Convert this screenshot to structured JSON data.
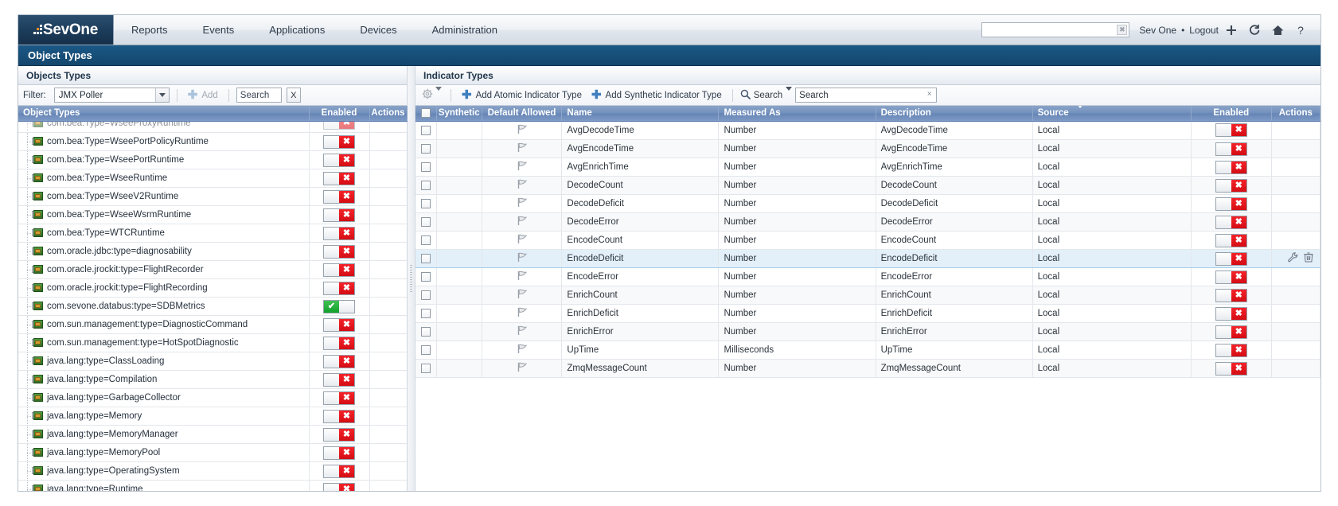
{
  "app": {
    "brand": "SevOne",
    "nav": [
      "Reports",
      "Events",
      "Applications",
      "Devices",
      "Administration"
    ],
    "search_value": "",
    "search_placeholder": "",
    "user": "Sev One",
    "separator": "•",
    "logout": "Logout",
    "icons": [
      "plus-icon",
      "refresh-icon",
      "home-icon",
      "help-icon"
    ],
    "page_title": "Object Types"
  },
  "left_panel": {
    "header": "Objects Types",
    "toolbar": {
      "filter_label": "Filter:",
      "filter_value": "JMX Poller",
      "add_label": "Add",
      "search_value": "Search",
      "clear_label": "X"
    },
    "columns": [
      "Object Types",
      "Enabled",
      "Actions"
    ],
    "rows": [
      {
        "name": "com.bea:Type=WseeProxyRuntime",
        "enabled": false,
        "partial": true
      },
      {
        "name": "com.bea:Type=WseePortPolicyRuntime",
        "enabled": false
      },
      {
        "name": "com.bea:Type=WseePortRuntime",
        "enabled": false
      },
      {
        "name": "com.bea:Type=WseeRuntime",
        "enabled": false
      },
      {
        "name": "com.bea:Type=WseeV2Runtime",
        "enabled": false
      },
      {
        "name": "com.bea:Type=WseeWsrmRuntime",
        "enabled": false
      },
      {
        "name": "com.bea:Type=WTCRuntime",
        "enabled": false
      },
      {
        "name": "com.oracle.jdbc:type=diagnosability",
        "enabled": false
      },
      {
        "name": "com.oracle.jrockit:type=FlightRecorder",
        "enabled": false
      },
      {
        "name": "com.oracle.jrockit:type=FlightRecording",
        "enabled": false
      },
      {
        "name": "com.sevone.databus:type=SDBMetrics",
        "enabled": true
      },
      {
        "name": "com.sun.management:type=DiagnosticCommand",
        "enabled": false
      },
      {
        "name": "com.sun.management:type=HotSpotDiagnostic",
        "enabled": false
      },
      {
        "name": "java.lang:type=ClassLoading",
        "enabled": false
      },
      {
        "name": "java.lang:type=Compilation",
        "enabled": false
      },
      {
        "name": "java.lang:type=GarbageCollector",
        "enabled": false
      },
      {
        "name": "java.lang:type=Memory",
        "enabled": false
      },
      {
        "name": "java.lang:type=MemoryManager",
        "enabled": false
      },
      {
        "name": "java.lang:type=MemoryPool",
        "enabled": false
      },
      {
        "name": "java.lang:type=OperatingSystem",
        "enabled": false
      },
      {
        "name": "java.lang:type=Runtime",
        "enabled": false
      }
    ]
  },
  "right_panel": {
    "header": "Indicator Types",
    "toolbar": {
      "add_atomic": "Add Atomic Indicator Type",
      "add_synthetic": "Add Synthetic Indicator Type",
      "search_button": "Search",
      "search_value": "Search",
      "clear_label": "×"
    },
    "columns": [
      "Synthetic",
      "Default Allowed",
      "Name",
      "Measured As",
      "Description",
      "Source",
      "Enabled",
      "Actions"
    ],
    "sorted_column": "Source",
    "sort_direction": "desc",
    "rows": [
      {
        "name": "AvgDecodeTime",
        "measured_as": "Number",
        "description": "AvgDecodeTime",
        "source": "Local",
        "enabled": false
      },
      {
        "name": "AvgEncodeTime",
        "measured_as": "Number",
        "description": "AvgEncodeTime",
        "source": "Local",
        "enabled": false
      },
      {
        "name": "AvgEnrichTime",
        "measured_as": "Number",
        "description": "AvgEnrichTime",
        "source": "Local",
        "enabled": false
      },
      {
        "name": "DecodeCount",
        "measured_as": "Number",
        "description": "DecodeCount",
        "source": "Local",
        "enabled": false
      },
      {
        "name": "DecodeDeficit",
        "measured_as": "Number",
        "description": "DecodeDeficit",
        "source": "Local",
        "enabled": false
      },
      {
        "name": "DecodeError",
        "measured_as": "Number",
        "description": "DecodeError",
        "source": "Local",
        "enabled": false
      },
      {
        "name": "EncodeCount",
        "measured_as": "Number",
        "description": "EncodeCount",
        "source": "Local",
        "enabled": false
      },
      {
        "name": "EncodeDeficit",
        "measured_as": "Number",
        "description": "EncodeDeficit",
        "source": "Local",
        "enabled": false,
        "highlighted": true
      },
      {
        "name": "EncodeError",
        "measured_as": "Number",
        "description": "EncodeError",
        "source": "Local",
        "enabled": false
      },
      {
        "name": "EnrichCount",
        "measured_as": "Number",
        "description": "EnrichCount",
        "source": "Local",
        "enabled": false
      },
      {
        "name": "EnrichDeficit",
        "measured_as": "Number",
        "description": "EnrichDeficit",
        "source": "Local",
        "enabled": false
      },
      {
        "name": "EnrichError",
        "measured_as": "Number",
        "description": "EnrichError",
        "source": "Local",
        "enabled": false
      },
      {
        "name": "UpTime",
        "measured_as": "Milliseconds",
        "description": "UpTime",
        "source": "Local",
        "enabled": false
      },
      {
        "name": "ZmqMessageCount",
        "measured_as": "Number",
        "description": "ZmqMessageCount",
        "source": "Local",
        "enabled": false
      }
    ]
  },
  "colors": {
    "brand_dark": "#15304a",
    "title_bar": "#14466c",
    "header_blue": "#7190bd",
    "toggle_off": "#d40d14",
    "toggle_on": "#13a12c",
    "accent_link": "#3f7fbf",
    "row_highlight": "#e3f0fa"
  }
}
